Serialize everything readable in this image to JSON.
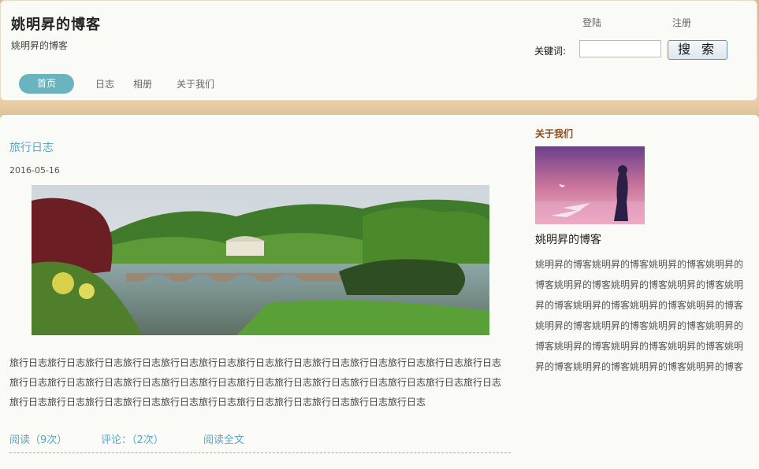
{
  "header": {
    "site_title": "姚明昇的博客",
    "site_subtitle": "姚明昇的博客",
    "login": "登陆",
    "register": "注册",
    "keyword_label": "关键词:",
    "keyword_value": "",
    "search_button": "搜索"
  },
  "nav": {
    "items": [
      {
        "label": "首页",
        "active": true
      },
      {
        "label": "日志"
      },
      {
        "label": "相册"
      },
      {
        "label": "关于我们"
      }
    ]
  },
  "post": {
    "title": "旅行日志",
    "date": "2016-05-16",
    "body": "旅行日志旅行日志旅行日志旅行日志旅行日志旅行日志旅行日志旅行日志旅行日志旅行日志旅行日志旅行日志旅行日志旅行日志旅行日志旅行日志旅行日志旅行日志旅行日志旅行日志旅行日志旅行日志旅行日志旅行日志旅行日志旅行日志旅行日志旅行日志旅行日志旅行日志旅行日志旅行日志旅行日志旅行日志旅行日志旅行日志旅行日志",
    "reads": "阅读（9次）",
    "comments": "评论：（2次）",
    "read_more": "阅读全文"
  },
  "sidebar": {
    "heading": "关于我们",
    "name": "姚明昇的博客",
    "body": "姚明昇的博客姚明昇的博客姚明昇的博客姚明昇的博客姚明昇的博客姚明昇的博客姚明昇的博客姚明昇的博客姚明昇的博客姚明昇的博客姚明昇的博客姚明昇的博客姚明昇的博客姚明昇的博客姚明昇的博客姚明昇的博客姚明昇的博客姚明昇的博客姚明昇的博客姚明昇的博客姚明昇的博客姚明昇的博客"
  },
  "colors": {
    "accent": "#6ab4c0",
    "link": "#5ba6c6",
    "heading_brown": "#8a4a1a",
    "page_bg": "#e3c79d"
  }
}
